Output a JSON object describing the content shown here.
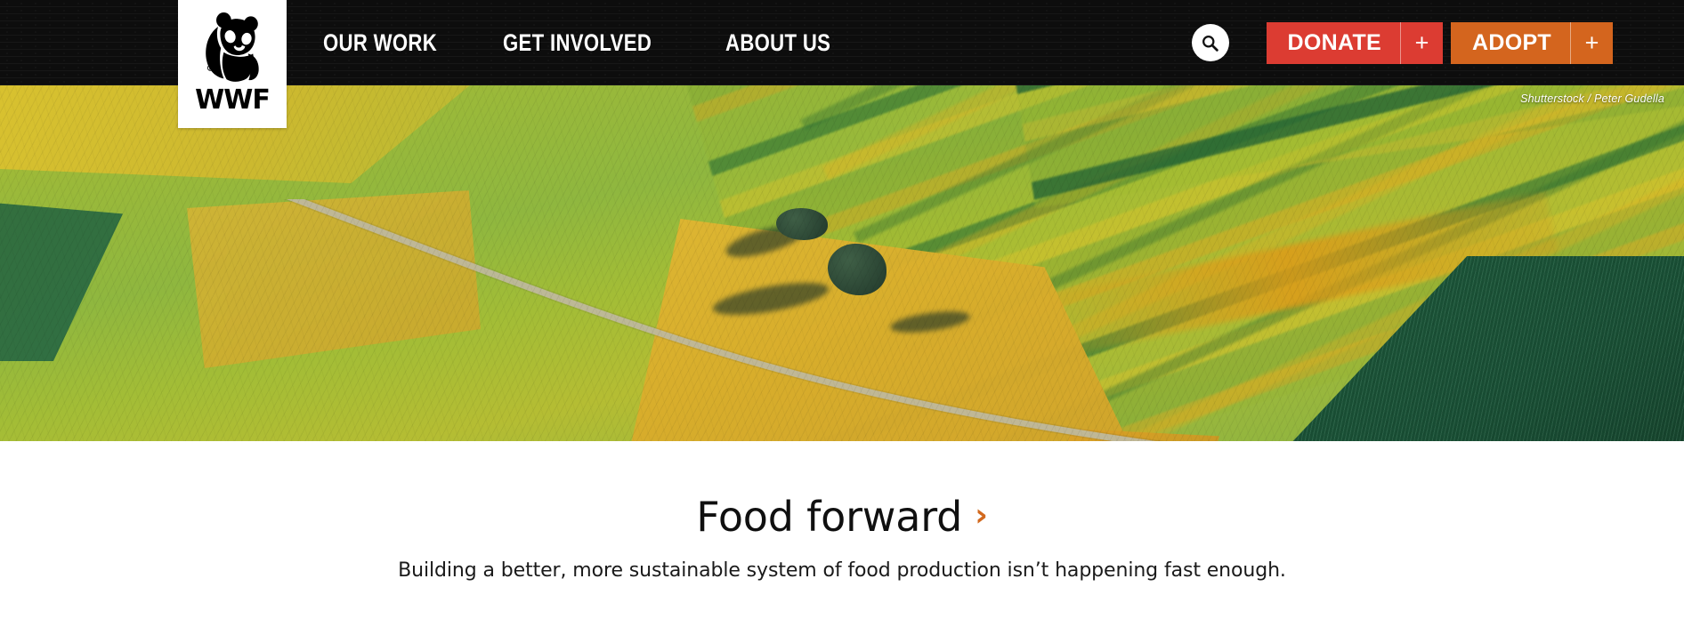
{
  "site": {
    "brand_name": "WWF",
    "logo_icon": "panda-logo-icon"
  },
  "header": {
    "background_color": "#0d0d0d",
    "nav_items": [
      {
        "label": "OUR WORK"
      },
      {
        "label": "GET INVOLVED"
      },
      {
        "label": "ABOUT US"
      }
    ],
    "search_icon": "search-icon",
    "buttons": [
      {
        "label": "DONATE",
        "plus": "+",
        "color": "#dc3c32"
      },
      {
        "label": "ADOPT",
        "plus": "+",
        "color": "#d4651e"
      }
    ]
  },
  "hero": {
    "image_description": "Aerial view of patchwork farmland fields with a winding road and trees",
    "credit": "Shutterstock / Peter Gudella"
  },
  "main": {
    "headline": "Food forward",
    "headline_chevron": "›",
    "subhead": "Building a better, more sustainable system of food production isn’t happening fast enough.",
    "accent_color": "#d2691e"
  }
}
